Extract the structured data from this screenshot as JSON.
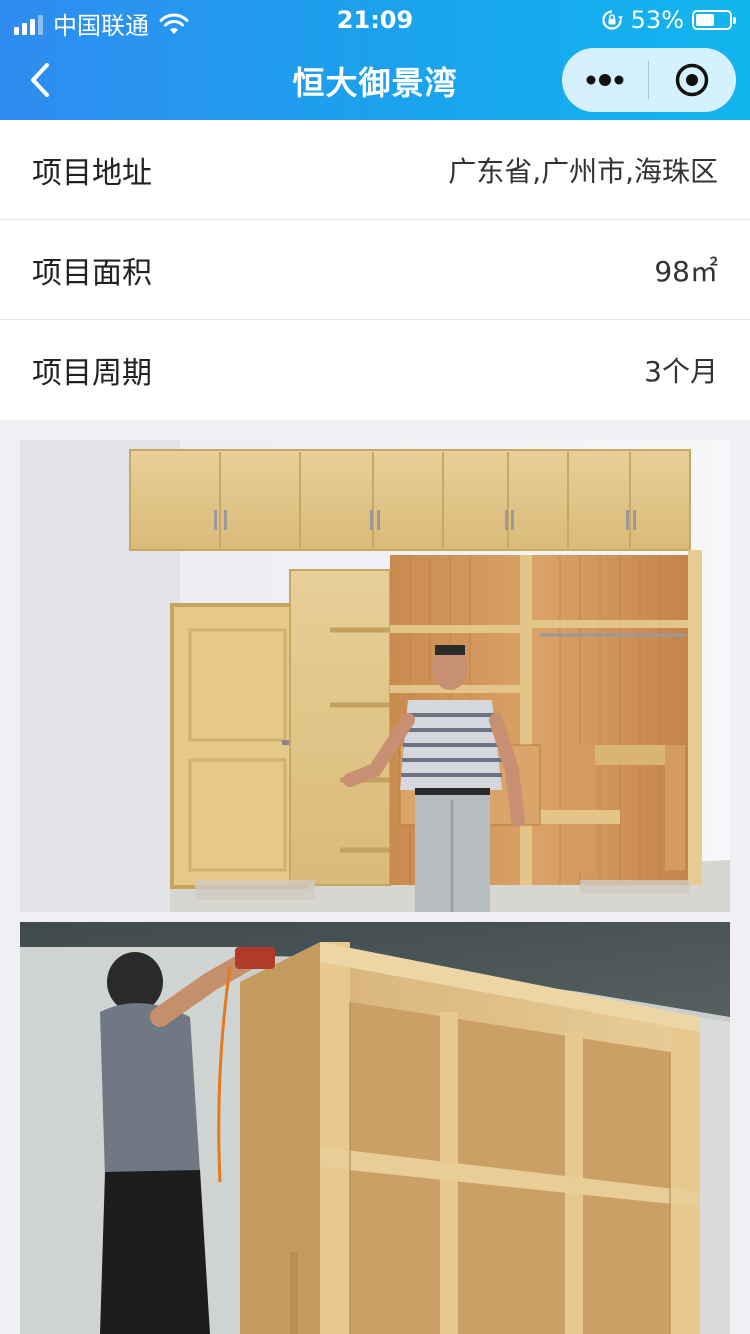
{
  "status_bar": {
    "carrier": "中国联通",
    "time": "21:09",
    "battery_percent": "53%",
    "battery_level": 0.53,
    "icons": [
      "signal-icon",
      "wifi-icon",
      "rotation-lock-icon",
      "battery-icon"
    ]
  },
  "nav": {
    "title": "恒大御景湾",
    "back_icon": "chevron-left-icon",
    "more_icon": "more-dots-icon",
    "close_icon": "target-close-icon"
  },
  "info": [
    {
      "label": "项目地址",
      "value": "广东省,广州市,海珠区"
    },
    {
      "label": "项目面积",
      "value": "98㎡"
    },
    {
      "label": "项目周期",
      "value": "3个月"
    }
  ],
  "photos": [
    {
      "subject": "installed wooden wardrobe with worker"
    },
    {
      "subject": "worker installing cabinet shelving"
    }
  ],
  "colors": {
    "header_gradient_start": "#2f8cf0",
    "header_gradient_end": "#12b6ee",
    "page_background": "#efeff4",
    "row_background": "#ffffff"
  }
}
